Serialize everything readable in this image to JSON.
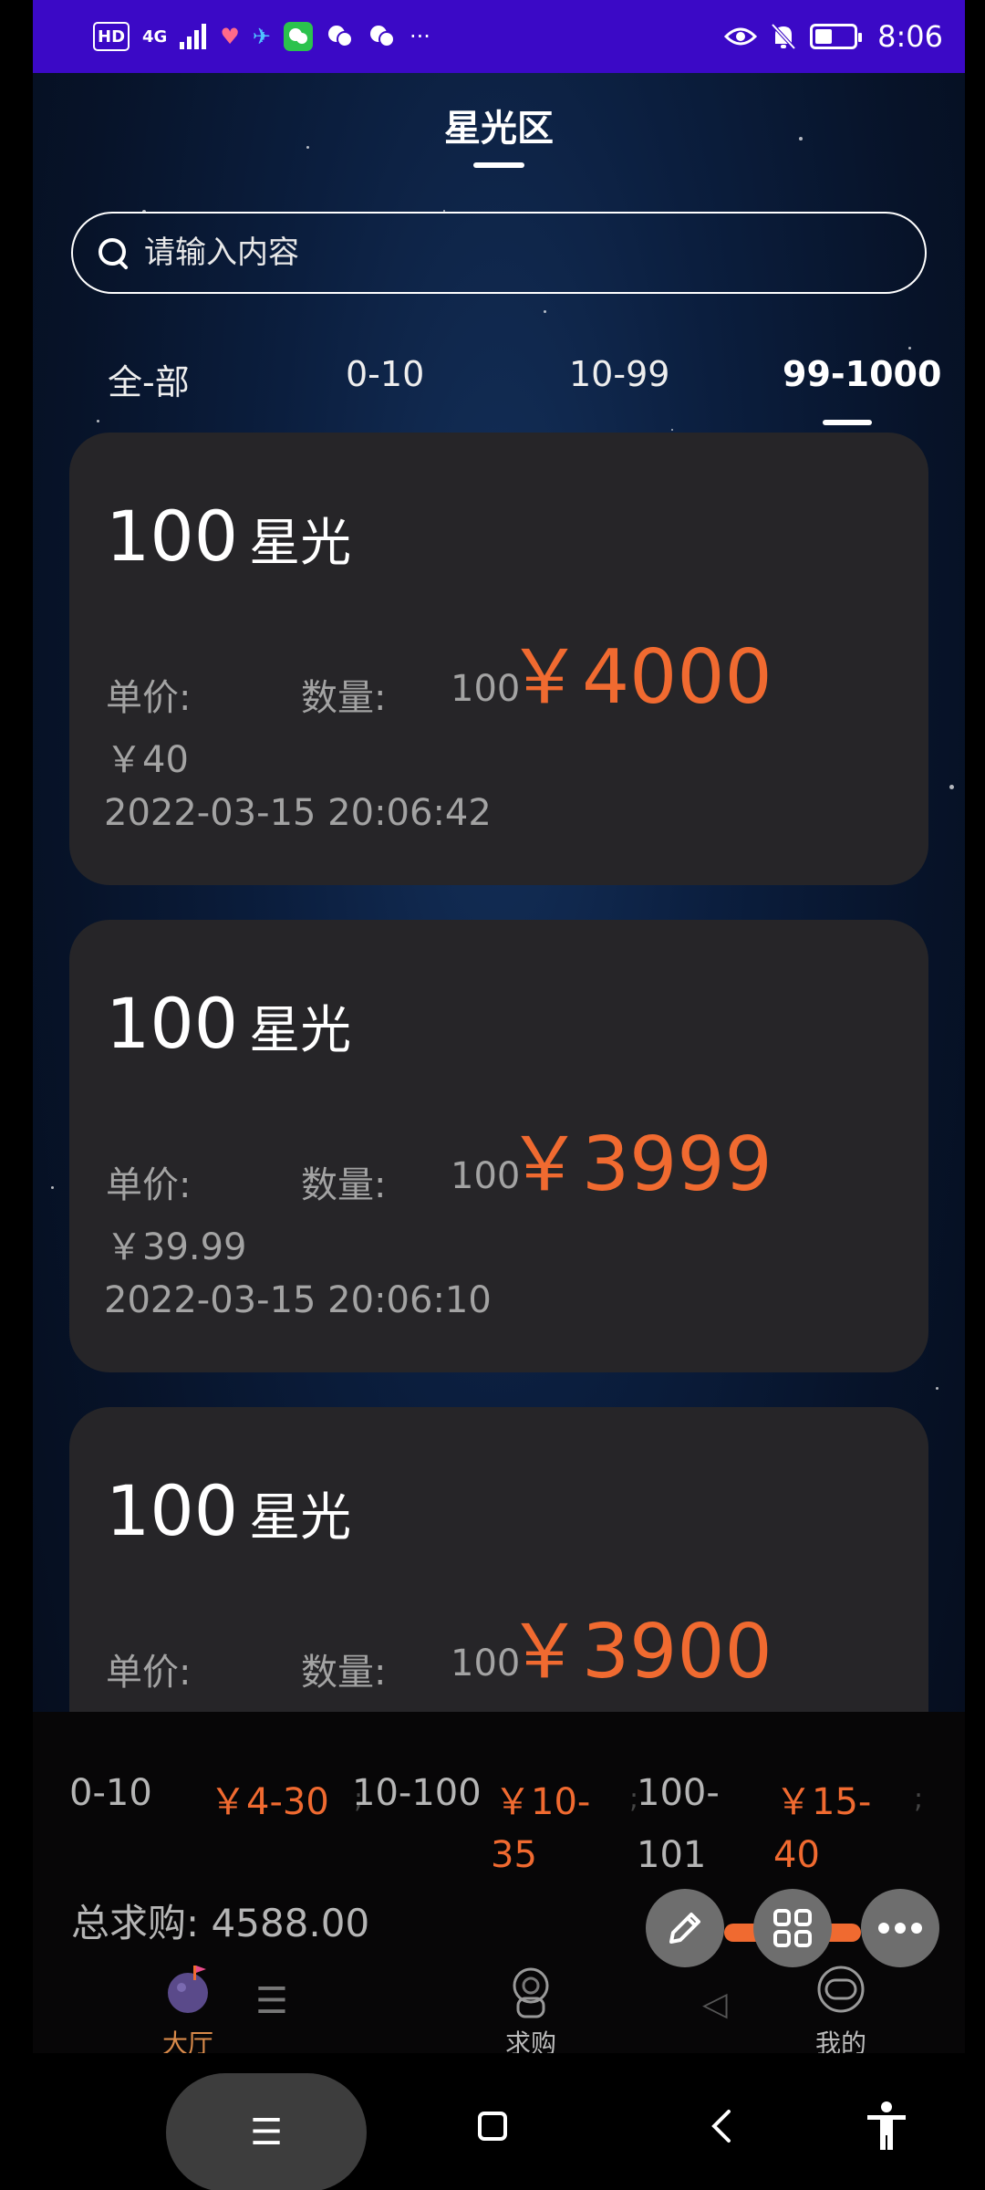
{
  "status_bar": {
    "hd": "HD",
    "network": "4G",
    "signal": "signal-bars-icon",
    "time": "8:06",
    "more": "···"
  },
  "header": {
    "title": "星光区"
  },
  "search": {
    "placeholder": "请输入内容"
  },
  "tabs": [
    {
      "label": "全-部",
      "active": false
    },
    {
      "label": "0-10",
      "active": false
    },
    {
      "label": "10-99",
      "active": false
    },
    {
      "label": "99-1000",
      "active": true
    }
  ],
  "cards": [
    {
      "amount": "100",
      "unit": "星光",
      "price_label": "单价:",
      "price": "￥40",
      "qty_label": "数量:",
      "qty": "100",
      "total": "￥4000",
      "time": "2022-03-15 20:06:42"
    },
    {
      "amount": "100",
      "unit": "星光",
      "price_label": "单价:",
      "price": "￥39.99",
      "qty_label": "数量:",
      "qty": "100",
      "total": "￥3999",
      "time": "2022-03-15 20:06:10"
    },
    {
      "amount": "100",
      "unit": "星光",
      "price_label": "单价:",
      "price": "",
      "qty_label": "数量:",
      "qty": "100",
      "total": "￥3900",
      "time": ""
    }
  ],
  "stats": {
    "items": [
      {
        "range": "0-10",
        "price": "￥4-30"
      },
      {
        "range": "10-100",
        "price_line1": "￥10-",
        "price_line2": "35"
      },
      {
        "range_line1": "100-",
        "range_line2": "101",
        "price_line1": "￥15-",
        "price_line2": "40"
      }
    ],
    "total": "总求购: 4588.00"
  },
  "nav": {
    "items": [
      {
        "label": "大厅",
        "icon": "planet-icon",
        "active": true
      },
      {
        "label": "求购",
        "icon": "astronaut-icon",
        "active": false
      },
      {
        "label": "我的",
        "icon": "helmet-icon",
        "active": false
      }
    ]
  },
  "fabs": [
    "pencil-icon",
    "grid-icon",
    "more-icon"
  ],
  "colors": {
    "accent": "#f06a30",
    "card": "#262528",
    "status_bar": "#3b09c6"
  }
}
